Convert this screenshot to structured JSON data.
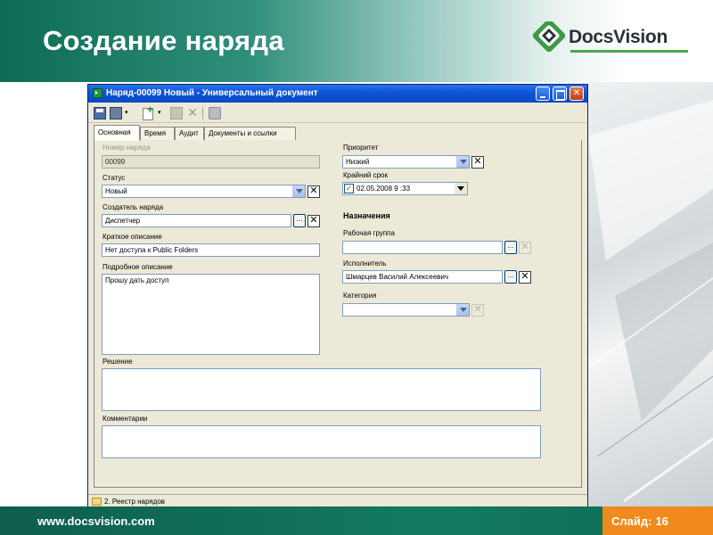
{
  "slide": {
    "title": "Создание наряда",
    "logo_text": "DocsVision",
    "footer_url": "www.docsvision.com",
    "slide_label": "Слайд:",
    "slide_number": "16"
  },
  "window": {
    "title": "Наряд-00099 Новый - Универсальный документ",
    "toolbar": {
      "icons": [
        "save-icon",
        "save-as-icon",
        "dropdown-arrow-icon",
        "new-document-icon",
        "dropdown-arrow-icon",
        "paste-icon",
        "delete-icon",
        "print-icon"
      ],
      "dropdown_glyph": "▾",
      "delete_glyph": "✕"
    },
    "tabs": [
      "Основная",
      "Время",
      "Аудит",
      "Документы и ссылки"
    ],
    "active_tab": "Основная",
    "form": {
      "number": {
        "label": "Номер наряда",
        "value": "00099"
      },
      "status": {
        "label": "Статус",
        "value": "Новый"
      },
      "creator": {
        "label": "Создатель наряда",
        "value": "Диспетчер"
      },
      "short_desc": {
        "label": "Краткое описание",
        "value": "Нет доступа к Public Folders"
      },
      "full_desc": {
        "label": "Подробное описание",
        "value": "Прошу дать доступ"
      },
      "solution": {
        "label": "Решение",
        "value": ""
      },
      "comments": {
        "label": "Комментарии",
        "value": ""
      },
      "priority": {
        "label": "Приоритет",
        "value": "Низкий"
      },
      "deadline": {
        "label": "Крайний срок",
        "value": "02.05.2008  9 :33",
        "checked": true
      },
      "assignments_heading": "Назначения",
      "work_group": {
        "label": "Рабочая группа",
        "value": ""
      },
      "executor": {
        "label": "Исполнитель",
        "value": "Шмарцев Василий Алексеевич"
      },
      "category": {
        "label": "Категория",
        "value": ""
      },
      "clear_glyph": "✕",
      "browse_glyph": "...",
      "check_glyph": "✓"
    },
    "statusbar": "2. Реестр нарядов"
  }
}
